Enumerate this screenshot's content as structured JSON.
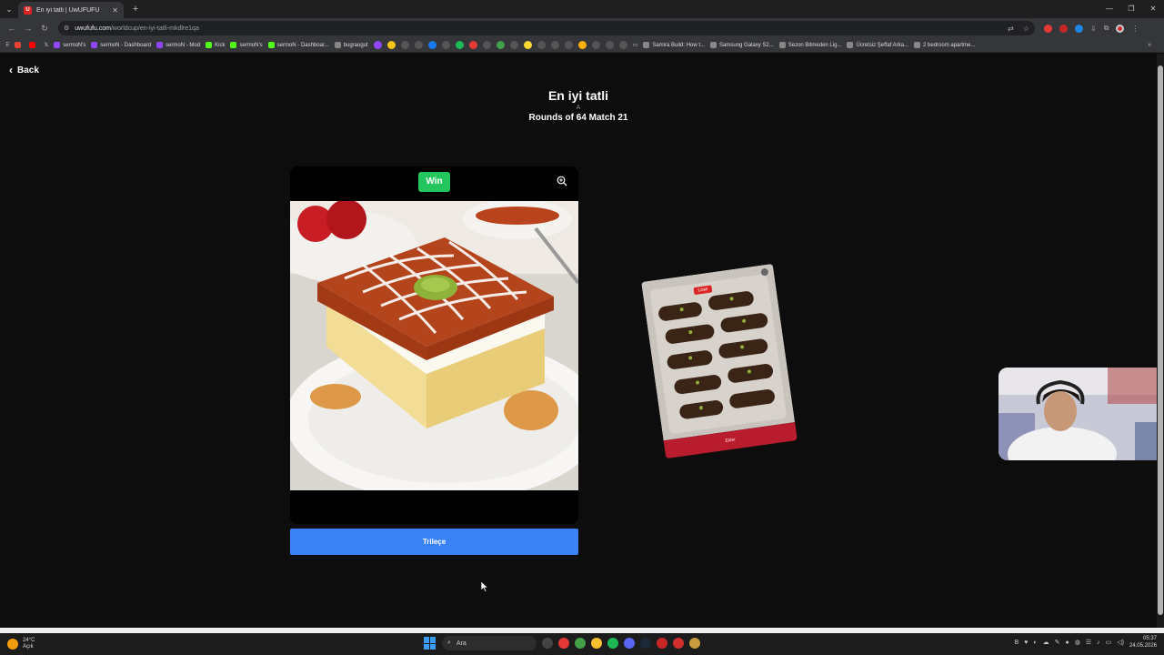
{
  "browser": {
    "tab_title": "En iyi tatli | UwUFUFU",
    "tab_favicon": "U",
    "url_host": "uwufufu.com",
    "url_path": "/worldcup/en-iyi-tatli-mkdlre1qa",
    "bookmarks": [
      "sermoN's",
      "sermoN - Dashboard",
      "sermoN - Mod",
      "Kick",
      "sermoN's",
      "sermoN - Dashboar...",
      "bugraogut",
      "Samira Build: How t...",
      "Samsung Galaxy S2...",
      "Sezon Bitmeden Lig...",
      "Ücretsiz Şeffaf Arka...",
      "2 bedroom apartme..."
    ]
  },
  "page": {
    "back_label": "Back",
    "title": "En iyi tatli",
    "subtitle": "A",
    "round_info": "Rounds of 64 Match 21"
  },
  "winner": {
    "badge": "Win",
    "button_label": "Trileçe"
  },
  "loser": {
    "badge": "Lose",
    "label": "Ekler"
  },
  "taskbar": {
    "temperature": "24°C",
    "weather_text": "Açık",
    "search_placeholder": "Ara",
    "time": "05:37",
    "date": "24.05.2026"
  },
  "colors": {
    "win_badge": "#22c55e",
    "choice_button": "#3b82f6",
    "lose_bar": "#b91c2c"
  }
}
